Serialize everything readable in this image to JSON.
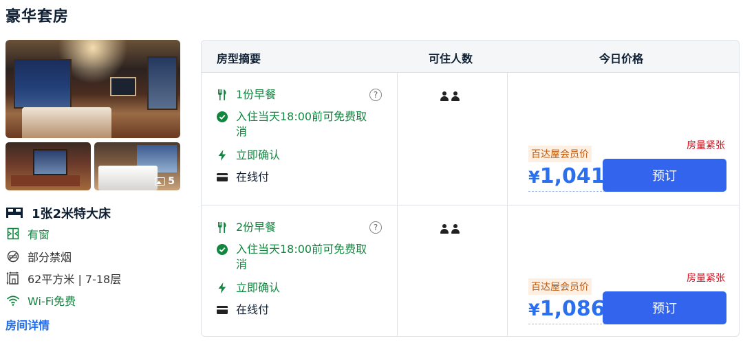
{
  "room": {
    "title": "豪华套房",
    "photo_count": "5",
    "bed": "1张2米特大床",
    "facilities": [
      {
        "icon": "window-icon",
        "label": "有窗",
        "highlight": true
      },
      {
        "icon": "no-smoking-icon",
        "label": "部分禁烟",
        "highlight": false
      },
      {
        "icon": "area-icon",
        "label": "62平方米 | 7-18层",
        "highlight": false
      },
      {
        "icon": "wifi-icon",
        "label": "Wi-Fi免费",
        "highlight": true
      }
    ],
    "details_link": "房间详情"
  },
  "table": {
    "headers": [
      "房型摘要",
      "可住人数",
      "今日价格"
    ],
    "rows": [
      {
        "breakfast": "1份早餐",
        "cancel_line1": "入住当天18:00前可免费取",
        "cancel_line2": "消",
        "confirm": "立即确认",
        "payment": "在线付",
        "guests": 2,
        "stock": "房量紧张",
        "member_label": "百达屋会员价",
        "currency": "¥",
        "price": "1,041",
        "book_label": "预订"
      },
      {
        "breakfast": "2份早餐",
        "cancel_line1": "入住当天18:00前可免费取",
        "cancel_line2": "消",
        "confirm": "立即确认",
        "payment": "在线付",
        "guests": 2,
        "stock": "房量紧张",
        "member_label": "百达屋会员价",
        "currency": "¥",
        "price": "1,086",
        "book_label": "预订"
      }
    ]
  },
  "colors": {
    "green": "#10863f",
    "price_blue": "#2a6ff0",
    "button_blue": "#3264ed",
    "alert_red": "#d1101d",
    "member_orange": "#c15a0e"
  }
}
